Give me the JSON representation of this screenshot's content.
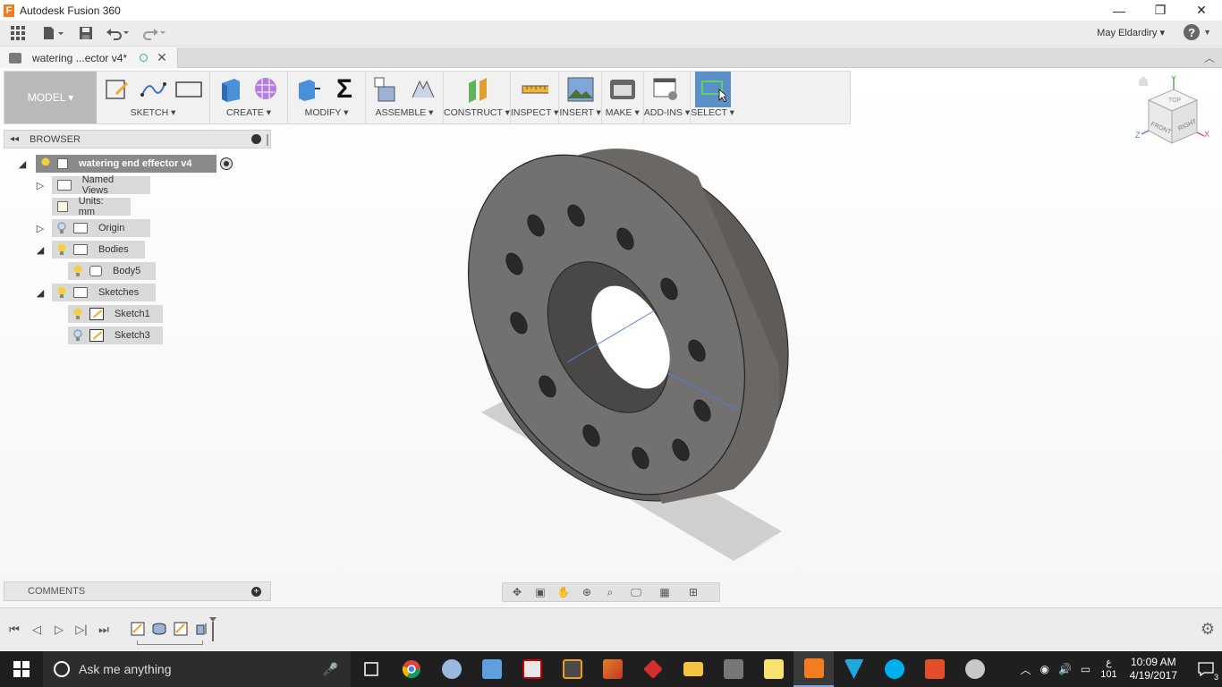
{
  "window": {
    "title": "Autodesk Fusion 360",
    "app_icon": "F",
    "minimize": "—",
    "maximize": "❐",
    "close": "✕"
  },
  "quick_access": {
    "user": "May Eldardiry ▾",
    "help": "?"
  },
  "document_tab": {
    "name": "watering ...ector v4*"
  },
  "toolbar": {
    "workspace": "MODEL ▾",
    "groups": [
      {
        "label": "SKETCH ▾"
      },
      {
        "label": "CREATE ▾"
      },
      {
        "label": "MODIFY ▾"
      },
      {
        "label": "ASSEMBLE ▾"
      },
      {
        "label": "CONSTRUCT ▾"
      },
      {
        "label": "INSPECT ▾"
      },
      {
        "label": "INSERT ▾"
      },
      {
        "label": "MAKE ▾"
      },
      {
        "label": "ADD-INS ▾"
      },
      {
        "label": "SELECT ▾"
      }
    ],
    "sigma": "Σ"
  },
  "browser": {
    "header": "BROWSER",
    "root": "watering end effector v4",
    "items": [
      {
        "label": "Named Views"
      },
      {
        "label": "Units: mm"
      },
      {
        "label": "Origin"
      },
      {
        "label": "Bodies"
      },
      {
        "label": "Body5"
      },
      {
        "label": "Sketches"
      },
      {
        "label": "Sketch1"
      },
      {
        "label": "Sketch3"
      }
    ]
  },
  "comments": {
    "header": "COMMENTS"
  },
  "viewcube": {
    "top": "TOP",
    "front": "FRONT",
    "right": "RIGHT",
    "x": "X",
    "y": "Y",
    "z": "Z"
  },
  "taskbar": {
    "search_placeholder": "Ask me anything",
    "lang": "ع",
    "lang_num": "101",
    "time": "10:09 AM",
    "date": "4/19/2017",
    "notifications": "3"
  },
  "colors": {
    "select_active": "#5b8fc7",
    "model_button": "#b9b9b9",
    "taskbar": "#1f1f1f",
    "part_face": "#6b6866"
  }
}
